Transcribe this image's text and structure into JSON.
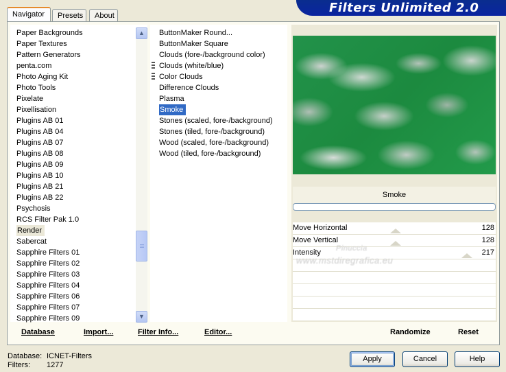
{
  "tabs": [
    {
      "label": "Navigator",
      "active": true
    },
    {
      "label": "Presets",
      "active": false
    },
    {
      "label": "About",
      "active": false
    }
  ],
  "banner": {
    "title": "Filters Unlimited 2.0"
  },
  "categories": [
    "Paper Backgrounds",
    "Paper Textures",
    "Pattern Generators",
    "penta.com",
    "Photo Aging Kit",
    "Photo Tools",
    "Pixelate",
    "Pixellisation",
    "Plugins AB 01",
    "Plugins AB 04",
    "Plugins AB 07",
    "Plugins AB 08",
    "Plugins AB 09",
    "Plugins AB 10",
    "Plugins AB 21",
    "Plugins AB 22",
    "Psychosis",
    "RCS Filter Pak 1.0",
    "Render",
    "Sabercat",
    "Sapphire Filters 01",
    "Sapphire Filters 02",
    "Sapphire Filters 03",
    "Sapphire Filters 04",
    "Sapphire Filters 06",
    "Sapphire Filters 07",
    "Sapphire Filters 09"
  ],
  "selected_category": "Render",
  "filters": [
    {
      "label": "ButtonMaker Round...",
      "marker": false
    },
    {
      "label": "ButtonMaker Square",
      "marker": false
    },
    {
      "label": "Clouds (fore-/background color)",
      "marker": false
    },
    {
      "label": "Clouds (white/blue)",
      "marker": true
    },
    {
      "label": "Color Clouds",
      "marker": true
    },
    {
      "label": "Difference Clouds",
      "marker": false
    },
    {
      "label": "Plasma",
      "marker": false
    },
    {
      "label": "Smoke",
      "marker": false
    },
    {
      "label": "Stones (scaled, fore-/background)",
      "marker": false
    },
    {
      "label": "Stones (tiled, fore-/background)",
      "marker": false
    },
    {
      "label": "Wood (scaled, fore-/background)",
      "marker": false
    },
    {
      "label": "Wood (tiled, fore-/background)",
      "marker": false
    }
  ],
  "selected_filter": "Smoke",
  "preview": {
    "filter_name": "Smoke"
  },
  "params": [
    {
      "label": "Move Horizontal",
      "value": "128"
    },
    {
      "label": "Move Vertical",
      "value": "128"
    },
    {
      "label": "Intensity",
      "value": "217"
    }
  ],
  "toolbar": {
    "database": "Database",
    "import": "Import...",
    "filter_info": "Filter Info...",
    "editor": "Editor...",
    "randomize": "Randomize",
    "reset": "Reset"
  },
  "footer": {
    "database_label": "Database:",
    "database_value": "ICNET-Filters",
    "filters_label": "Filters:",
    "filters_value": "1277"
  },
  "buttons": {
    "apply": "Apply",
    "cancel": "Cancel",
    "help": "Help"
  },
  "watermark": {
    "line1": "Pinuccia",
    "line2": "www.mstdiregrafica.eu"
  }
}
